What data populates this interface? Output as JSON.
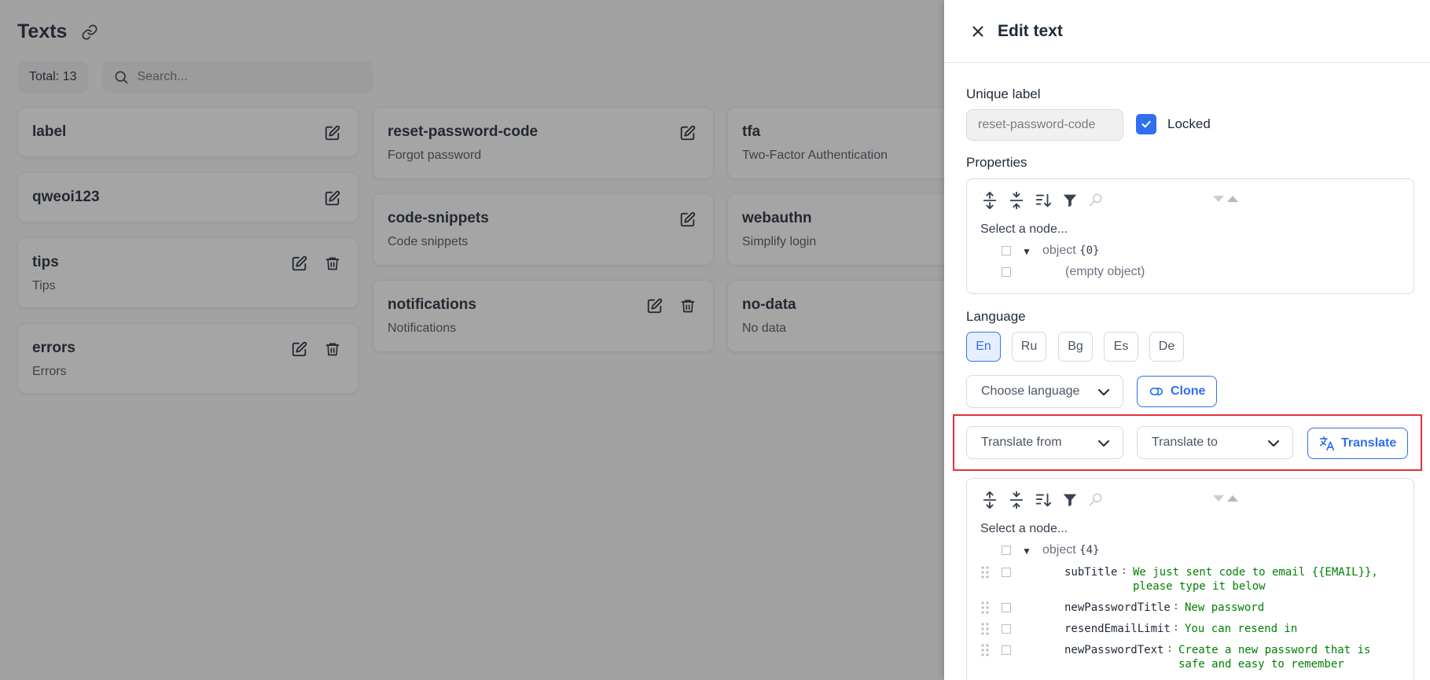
{
  "page": {
    "title": "Texts",
    "total_label": "Total: 13",
    "search_placeholder": "Search..."
  },
  "cards": [
    {
      "name": "label",
      "description": ""
    },
    {
      "name": "qweoi123",
      "description": ""
    },
    {
      "name": "tips",
      "description": "Tips"
    },
    {
      "name": "errors",
      "description": "Errors"
    },
    {
      "name": "reset-password-code",
      "description": "Forgot password"
    },
    {
      "name": "code-snippets",
      "description": "Code snippets"
    },
    {
      "name": "notifications",
      "description": "Notifications"
    },
    {
      "name": "tfa",
      "description": "Two-Factor Authentication"
    },
    {
      "name": "webauthn",
      "description": "Simplify login"
    },
    {
      "name": "no-data",
      "description": "No data"
    }
  ],
  "drawer": {
    "title": "Edit text",
    "unique_label": "Unique label",
    "unique_value": "reset-password-code",
    "locked_label": "Locked",
    "properties_label": "Properties",
    "language_label": "Language",
    "languages": [
      "En",
      "Ru",
      "Bg",
      "Es",
      "De"
    ],
    "active_language": "En",
    "choose_language_placeholder": "Choose language",
    "clone_label": "Clone",
    "translate_from_placeholder": "Translate from",
    "translate_to_placeholder": "Translate to",
    "translate_label": "Translate"
  },
  "properties_editor": {
    "select_hint": "Select a node...",
    "root_type": "object",
    "root_count": "{0}",
    "empty_text": "(empty object)"
  },
  "translation_editor": {
    "select_hint": "Select a node...",
    "root_type": "object",
    "root_count": "{4}",
    "entries": [
      {
        "key": "subTitle",
        "value": "We just sent code to email {{EMAIL}}, please type it below"
      },
      {
        "key": "newPasswordTitle",
        "value": "New password"
      },
      {
        "key": "resendEmailLimit",
        "value": "You can resend in"
      },
      {
        "key": "newPasswordText",
        "value": "Create a new password that is safe and easy to remember"
      }
    ]
  },
  "colors": {
    "accent": "#2f6ff0",
    "json_value": "#008000",
    "highlight": "#e0323b"
  }
}
